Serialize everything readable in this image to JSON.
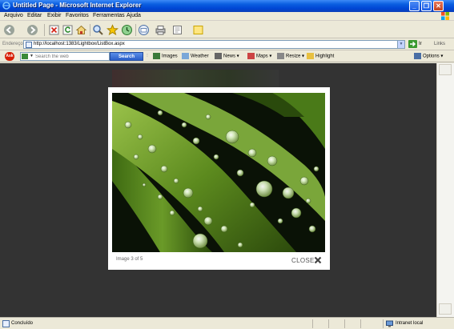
{
  "window": {
    "title": "Untitled Page - Microsoft Internet Explorer",
    "buttons": [
      "_",
      "❐",
      "✕"
    ]
  },
  "menu": [
    "Arquivo",
    "Editar",
    "Exibir",
    "Favoritos",
    "Ferramentas",
    "Ajuda"
  ],
  "address": {
    "label": "Endereço",
    "url": "http://localhost:1383/Lightbox/ListBox.aspx",
    "go_label": "Ir",
    "links_label": "Links"
  },
  "search_toolbar": {
    "placeholder": "Search the web",
    "search_button": "Search",
    "items": [
      "Images",
      "Weather",
      "News",
      "Maps",
      "Resize",
      "Highlight"
    ],
    "options_label": "Options"
  },
  "lightbox": {
    "caption": "Image 3 of 5",
    "close_label": "CLOSE",
    "photo_subject": "water droplets on green leaves"
  },
  "status": {
    "text": "Concluído",
    "zone": "Intranet local"
  },
  "colors": {
    "titlebar": "#0046d5",
    "content_bg": "#333333",
    "search_button": "#2c5fc8"
  }
}
